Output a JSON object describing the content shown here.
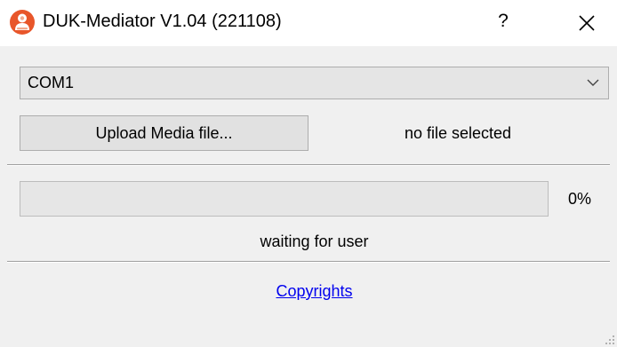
{
  "window": {
    "title": "DUK-Mediator V1.04 (221108)",
    "help_label": "?",
    "icons": {
      "app": "app-logo-icon",
      "close": "close-icon",
      "dropdown": "chevron-down-icon",
      "grip": "resize-grip-icon"
    }
  },
  "port_select": {
    "value": "COM1"
  },
  "upload": {
    "button_label": "Upload Media file...",
    "file_status": "no file selected"
  },
  "progress": {
    "value": 0,
    "text": "0%",
    "status": "waiting for user"
  },
  "footer": {
    "copyright_link": "Copyrights"
  },
  "colors": {
    "window_bg": "#f0f0f0",
    "titlebar_bg": "#ffffff",
    "button_bg": "#e1e1e1",
    "combo_bg": "#e5e5e5",
    "border": "#adadad",
    "progress_fill": "#06b025",
    "link": "#0000ee",
    "app_icon_orange": "#e8562a"
  }
}
